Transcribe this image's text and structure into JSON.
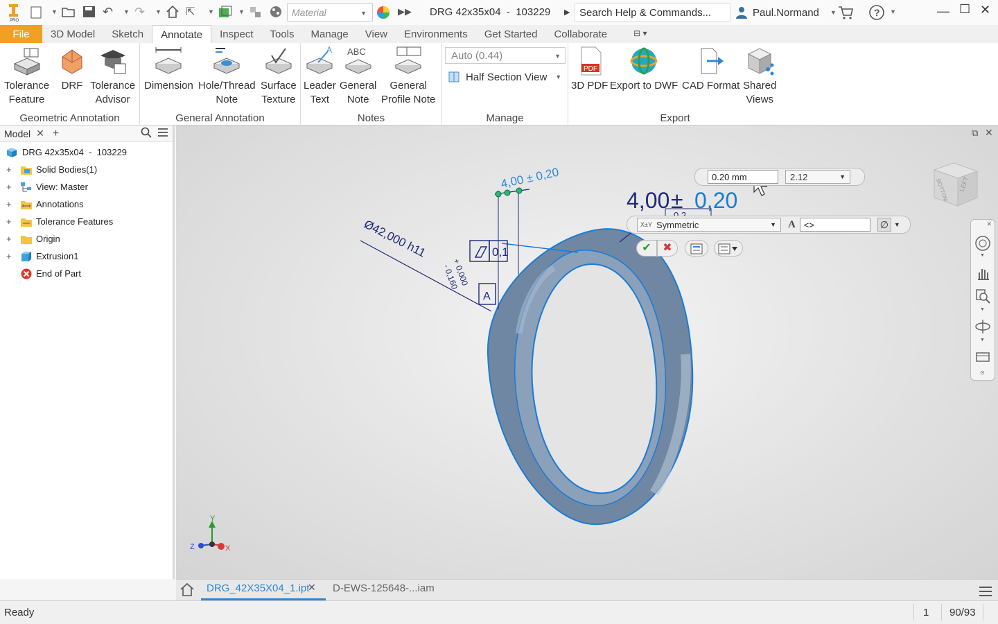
{
  "titlebar": {
    "material_placeholder": "Material",
    "document_title": "DRG 42x35x04  -  103229",
    "search_placeholder": "Search Help & Commands...",
    "user_name": "Paul.Normand"
  },
  "menu": {
    "file": "File",
    "tabs": [
      "3D Model",
      "Sketch",
      "Annotate",
      "Inspect",
      "Tools",
      "Manage",
      "View",
      "Environments",
      "Get Started",
      "Collaborate"
    ],
    "active_tab": "Annotate"
  },
  "ribbon": {
    "geometric_annotation": {
      "title": "Geometric Annotation",
      "tolerance_feature": [
        "Tolerance",
        "Feature"
      ],
      "drf": "DRF",
      "tolerance_advisor": [
        "Tolerance",
        "Advisor"
      ]
    },
    "general_annotation": {
      "title": "General Annotation",
      "dimension": "Dimension",
      "hole_thread_note": [
        "Hole/Thread",
        "Note"
      ],
      "surface_texture": [
        "Surface",
        "Texture"
      ]
    },
    "notes": {
      "title": "Notes",
      "leader_text": [
        "Leader",
        "Text"
      ],
      "general_note": [
        "General",
        "Note"
      ],
      "general_profile_note": [
        "General",
        "Profile Note"
      ]
    },
    "manage": {
      "title": "Manage",
      "scale_value": "Auto (0.44)",
      "half_section_view": "Half Section View"
    },
    "export": {
      "title": "Export",
      "pdf_badge": "PDF",
      "pdf_3d": "3D PDF",
      "export_dwf": "Export to DWF",
      "cad_format": "CAD Format",
      "shared_views": [
        "Shared",
        "Views"
      ]
    }
  },
  "browser": {
    "tab_label": "Model",
    "root": "DRG 42x35x04  -  103229",
    "items": [
      {
        "label": "Solid Bodies(1)",
        "expand": "+"
      },
      {
        "label": "View: Master",
        "expand": "+"
      },
      {
        "label": "Annotations",
        "expand": "+"
      },
      {
        "label": "Tolerance Features",
        "expand": "+"
      },
      {
        "label": "Origin",
        "expand": "+"
      },
      {
        "label": "Extrusion1",
        "expand": "+"
      },
      {
        "label": "End of Part",
        "expand": ""
      }
    ]
  },
  "viewport": {
    "small_dim_text": "4,00 ± 0,20",
    "diameter_text": "Ø42,000 h11",
    "upper_tol": "+ 0,000",
    "lower_tol": "- 0,160",
    "flatness_value": "0,1",
    "datum_label": "A",
    "big_dim_value": "4,00",
    "big_dim_pm": "±",
    "big_dim_tol": "0,20",
    "partial_frame_text": "0,2",
    "tolerance_input_value": "0.20 mm",
    "precision_value": "2.12",
    "tolerance_type_prefix": "X±Y",
    "tolerance_type": "Symmetric",
    "text_input_value": "<>",
    "text_icon": "A",
    "viewcube_faces": [
      "BOTTOM",
      "LEFT"
    ],
    "triad": {
      "x": "X",
      "y": "Y",
      "z": "Z"
    }
  },
  "doc_tabs": {
    "active": "DRG_42X35X04_1.ipt",
    "other": "D-EWS-125648-...iam"
  },
  "status": {
    "text": "Ready",
    "count": "1",
    "pages": "90/93"
  },
  "colors": {
    "accent_orange": "#f2a024",
    "annotation_navy": "#1e2a78",
    "active_blue": "#1a7bd6",
    "part_steel": "#6f87a3",
    "tab_underline": "#2e86d9"
  }
}
